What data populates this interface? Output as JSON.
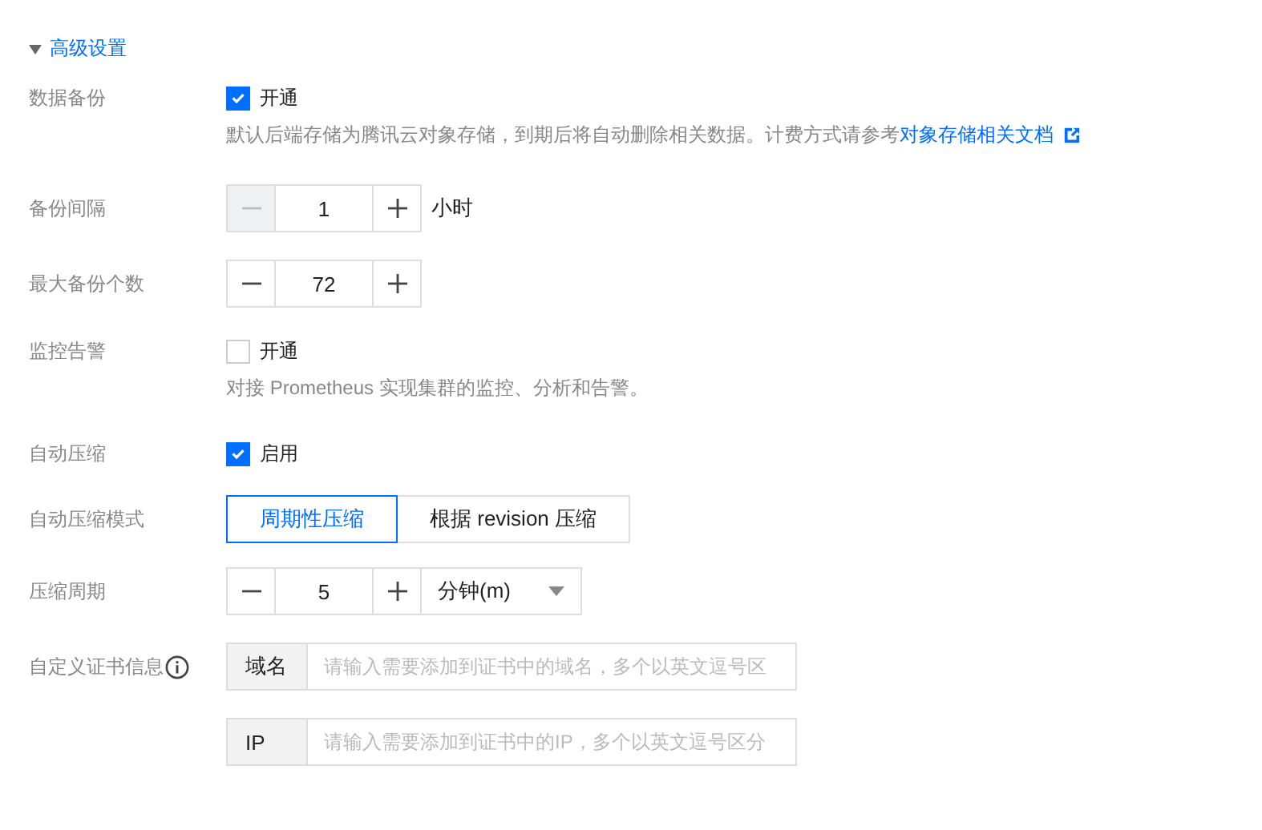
{
  "section": {
    "title": "高级设置",
    "expanded": true
  },
  "rows": [
    {
      "kind": "checkbox",
      "label": "数据备份",
      "option": "开通",
      "checked": true,
      "hint": "默认后端存储为腾讯云对象存储，到期后将自动删除相关数据。计费方式请参考",
      "link": "对象存储相关文档"
    },
    {
      "kind": "stepper",
      "label": "备份间隔",
      "value": "1",
      "minus_disabled": true,
      "unit": "小时"
    },
    {
      "kind": "stepper",
      "label": "最大备份个数",
      "value": "72",
      "minus_disabled": false
    },
    {
      "kind": "checkbox",
      "label": "监控告警",
      "option": "开通",
      "checked": false,
      "hint": "对接 Prometheus 实现集群的监控、分析和告警。"
    },
    {
      "kind": "checkbox",
      "label": "自动压缩",
      "option": "启用",
      "checked": true
    },
    {
      "kind": "segmented",
      "label": "自动压缩模式",
      "options": [
        {
          "label": "周期性压缩",
          "selected": true
        },
        {
          "label": "根据 revision 压缩",
          "selected": false
        }
      ]
    },
    {
      "kind": "stepper",
      "label": "压缩周期",
      "value": "5",
      "minus_disabled": false,
      "select": "分钟(m)"
    },
    {
      "kind": "inputs",
      "label": "自定义证书信息",
      "info": true,
      "fields": [
        {
          "addon": "域名",
          "placeholder": "请输入需要添加到证书中的域名，多个以英文逗号区"
        },
        {
          "addon": "IP",
          "placeholder": "请输入需要添加到证书中的IP，多个以英文逗号区分"
        }
      ]
    }
  ]
}
